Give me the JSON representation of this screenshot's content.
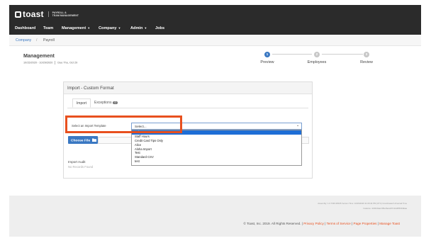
{
  "brand": {
    "name": "toast",
    "subtitle_line1": "PAYROLL &",
    "subtitle_line2": "TEAM MANAGEMENT"
  },
  "nav": {
    "items": [
      {
        "label": "Dashboard"
      },
      {
        "label": "Team"
      },
      {
        "label": "Management",
        "caret": "▼"
      },
      {
        "label": "Company",
        "caret": "▼"
      },
      {
        "label": "Admin",
        "caret": "▼"
      },
      {
        "label": "Jobs"
      }
    ]
  },
  "breadcrumb": {
    "company": "Company",
    "separator": "/",
    "current": "Payroll"
  },
  "header": {
    "title": "Management",
    "date_range": "10/15/2020 - 10/29/2020",
    "due": "Due Thu, Oct 29"
  },
  "steps": [
    {
      "number": "1",
      "label": "Preview",
      "state": "active"
    },
    {
      "number": "2",
      "label": "Employees",
      "state": "inactive"
    },
    {
      "number": "3",
      "label": "Review",
      "state": "inactive"
    }
  ],
  "panel": {
    "title": "Import - Custom Format",
    "tabs": {
      "import": "Import",
      "exceptions": "Exceptions",
      "exceptions_count": "0"
    },
    "template_label": "Select an Import Template",
    "template_value": "Select...",
    "template_caret": "⌄",
    "dropdown_options": [
      "Select...",
      "Staff Hours",
      "Credit Card Tips Only",
      "Alice",
      "Aloha Import",
      "Test",
      "Standard CSV",
      "test"
    ],
    "selected_index": 0,
    "choose_file": "Choose File",
    "choose_file_icon": "folder-icon",
    "audit_label": "Import Audit",
    "audit_empty": "No Records Found"
  },
  "footer": {
    "meta_line1": "Assembly: 1.0.7393.28045 Version Time: 10/29/2020 11:00:44 PM (UTC) Coordinated Universal Time",
    "meta_line2": "Instance: 4436/4dac/4f6e/9aca/97c2dd6f6343Eaa",
    "copyright": "© Toast, Inc. 2019. All Rights Reserved. |",
    "privacy": "Privacy Policy",
    "sep1": "|",
    "terms": "Terms of Service",
    "sep2": "|",
    "page_props": "Page Properties",
    "sep3": "|",
    "manage": "Manage Toast"
  },
  "colors": {
    "brand_dark": "#2b2b2b",
    "accent_blue": "#3a78c2",
    "highlight": "#e8501e",
    "selected_option": "#1e6ed6"
  }
}
